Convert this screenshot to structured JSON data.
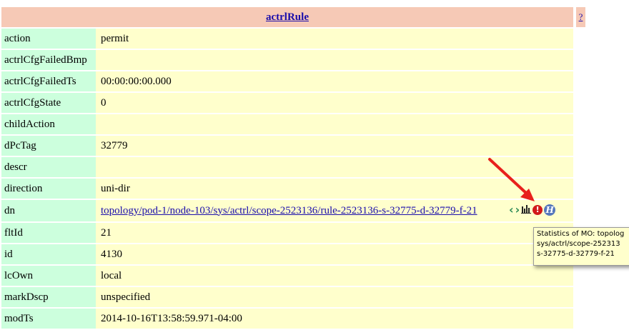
{
  "header": {
    "title": "actrlRule",
    "help_label": "?"
  },
  "rows": [
    {
      "key": "action",
      "value": "permit"
    },
    {
      "key": "actrlCfgFailedBmp",
      "value": ""
    },
    {
      "key": "actrlCfgFailedTs",
      "value": "00:00:00:00.000"
    },
    {
      "key": "actrlCfgState",
      "value": "0"
    },
    {
      "key": "childAction",
      "value": ""
    },
    {
      "key": "dPcTag",
      "value": "32779"
    },
    {
      "key": "descr",
      "value": ""
    },
    {
      "key": "direction",
      "value": "uni-dir"
    },
    {
      "key": "dn",
      "value": "topology/pod-1/node-103/sys/actrl/scope-2523136/rule-2523136-s-32775-d-32779-f-21"
    },
    {
      "key": "fltId",
      "value": "21"
    },
    {
      "key": "id",
      "value": "4130"
    },
    {
      "key": "lcOwn",
      "value": "local"
    },
    {
      "key": "markDscp",
      "value": "unspecified"
    },
    {
      "key": "modTs",
      "value": "2014-10-16T13:58:59.971-04:00"
    }
  ],
  "dn_icons": {
    "prev": "‹",
    "next": "›",
    "fault": "!",
    "history": "H",
    "icon_names": [
      "chevron-left-icon",
      "chevron-right-icon",
      "stats-icon",
      "fault-icon",
      "history-icon"
    ]
  },
  "tooltip": {
    "text": "Statistics of MO: topolog\nsys/actrl/scope-252313\ns-32775-d-32779-f-21"
  },
  "colors": {
    "header_bg": "#f6c9b6",
    "key_bg": "#ccffdd",
    "value_bg": "#ffffcc",
    "link": "#1a0dab",
    "annotation_arrow": "#e8201c"
  }
}
